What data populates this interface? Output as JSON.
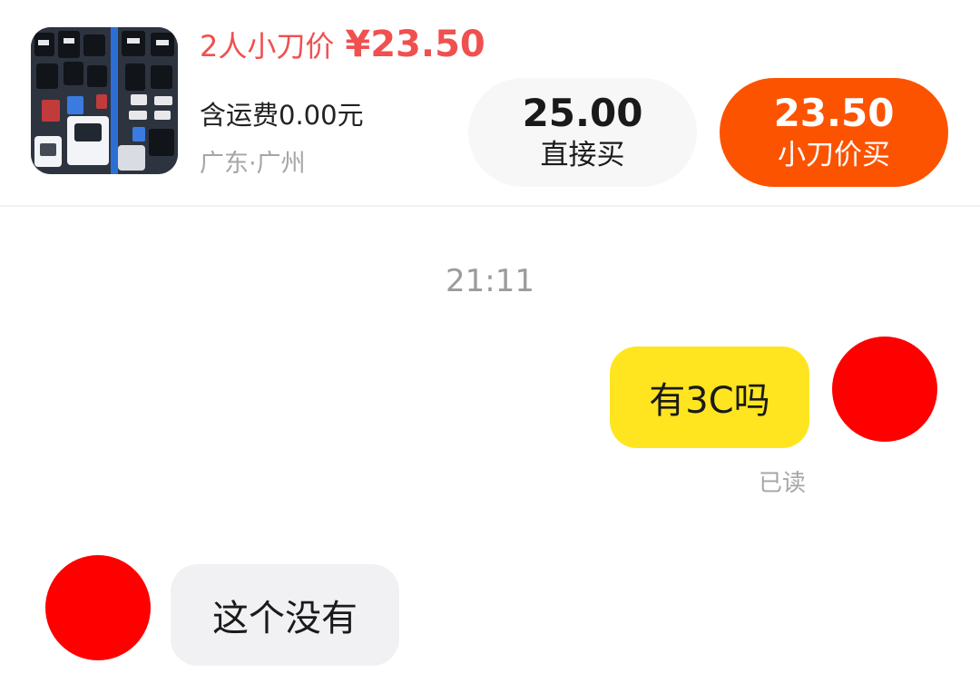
{
  "product": {
    "bargain_label": "2人小刀价",
    "bargain_price": "¥23.50",
    "shipping": "含运费0.00元",
    "location": "广东·广州",
    "image_icon": "product-thumbnail"
  },
  "buttons": {
    "direct_price": "25.00",
    "direct_label": "直接买",
    "bargain_price": "23.50",
    "bargain_label": "小刀价买"
  },
  "chat": {
    "timestamp": "21:11",
    "messages": [
      {
        "sender": "me",
        "text": "有3C吗",
        "status": "已读"
      },
      {
        "sender": "other",
        "text": "这个没有"
      }
    ]
  },
  "colors": {
    "bargain_text": "#f0504f",
    "bargain_button": "#fc5300",
    "my_bubble": "#ffe51f",
    "other_bubble": "#f1f1f3",
    "avatar": "#ff0000"
  }
}
